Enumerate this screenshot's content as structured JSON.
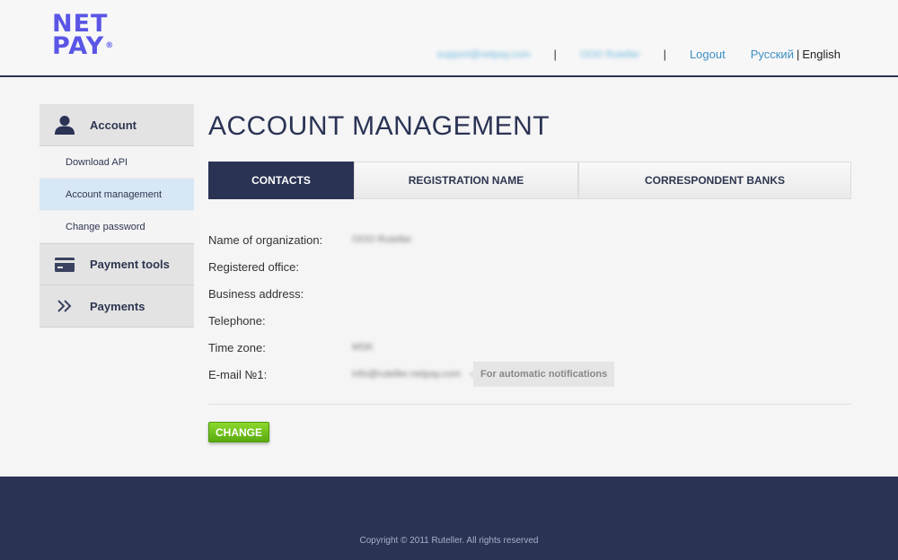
{
  "logo": {
    "line1": "NET",
    "line2": "PAY",
    "reg": "®"
  },
  "topnav": {
    "user_email": "support@netpay.com",
    "org_name": "OOO Ruteller",
    "separator": "|",
    "logout": "Logout",
    "lang_ru": "Русский",
    "lang_bar": "|",
    "lang_en": "English"
  },
  "sidebar": {
    "account": {
      "label": "Account",
      "icon": "user-icon"
    },
    "account_items": [
      {
        "label": "Download API"
      },
      {
        "label": "Account management",
        "active": true
      },
      {
        "label": "Change password"
      }
    ],
    "payment_tools": {
      "label": "Payment tools",
      "icon": "card-icon"
    },
    "payments": {
      "label": "Payments",
      "icon": "double-chevron-icon"
    }
  },
  "page_title": "ACCOUNT MANAGEMENT",
  "tabs": [
    {
      "label": "CONTACTS",
      "active": true
    },
    {
      "label": "REGISTRATION NAME"
    },
    {
      "label": "CORRESPONDENT BANKS"
    }
  ],
  "fields": {
    "organization": {
      "label": "Name of organization:",
      "value": "OOO Ruteller"
    },
    "registered_office": {
      "label": "Registered office:",
      "value": ""
    },
    "business_address": {
      "label": "Business address:",
      "value": ""
    },
    "telephone": {
      "label": "Telephone:",
      "value": ""
    },
    "time_zone": {
      "label": "Time zone:",
      "value": "MSK"
    },
    "email1": {
      "label": "E-mail №1:",
      "value": "info@ruteller.netpay.com",
      "hint": "For automatic notifications"
    }
  },
  "change_button": "CHANGE",
  "footer": {
    "copyright": "Copyright © 2011 Ruteller. All rights reserved"
  },
  "colors": {
    "navy": "#2a3354",
    "accent_blue": "#3e8fc4",
    "green": "#6cbf1a",
    "logo": "#5a55e6"
  }
}
